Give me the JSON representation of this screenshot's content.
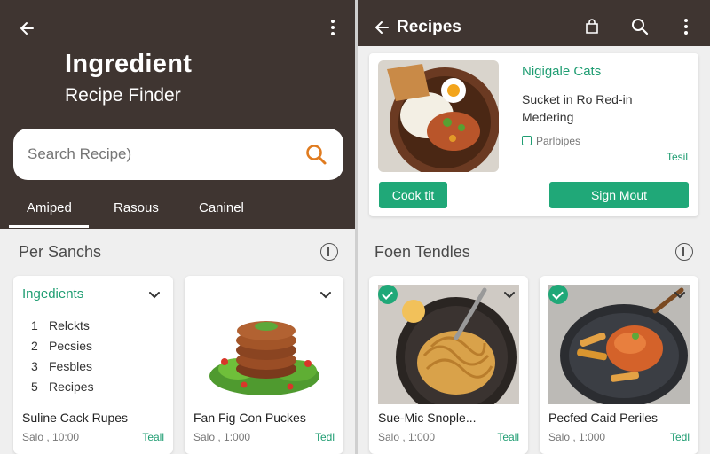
{
  "left": {
    "header": {
      "title": "Ingredient",
      "subtitle": "Recipe Finder"
    },
    "search": {
      "placeholder": "Search Recipe)"
    },
    "tabs": [
      {
        "label": "Amiped"
      },
      {
        "label": "Rasous"
      },
      {
        "label": "Caninel"
      }
    ],
    "section_title": "Per Sanchs",
    "cards": [
      {
        "title": "Ingedients",
        "items": [
          {
            "num": "1",
            "label": "Relckts"
          },
          {
            "num": "2",
            "label": "Pecsies"
          },
          {
            "num": "3",
            "label": "Fesbles"
          },
          {
            "num": "5",
            "label": "Recipes"
          }
        ],
        "name": "Suline Cack Rupes",
        "meta": "Salo , 10:00",
        "link": "Teall"
      },
      {
        "name": "Fan Fig Con Puckes",
        "meta": "Salo , 1:000",
        "link": "Tedl"
      }
    ]
  },
  "right": {
    "header": {
      "title": "Recipes"
    },
    "featured": {
      "title": "Nigigale Cats",
      "desc": "Sucket in Ro Red-in Medering",
      "meta": "Parlbipes",
      "link": "Tesil",
      "btn_primary": "Cook tit",
      "btn_secondary": "Sign Mout"
    },
    "section_title": "Foen Tendles",
    "cards": [
      {
        "name": "Sue-Mic Snople...",
        "meta": "Salo , 1:000",
        "link": "Teall"
      },
      {
        "name": "Pecfed Caid Periles",
        "meta": "Salo , 1:000",
        "link": "Tedl"
      }
    ]
  },
  "colors": {
    "header_bg": "#3f3531",
    "accent": "#20a878",
    "page_bg": "#efefef"
  }
}
